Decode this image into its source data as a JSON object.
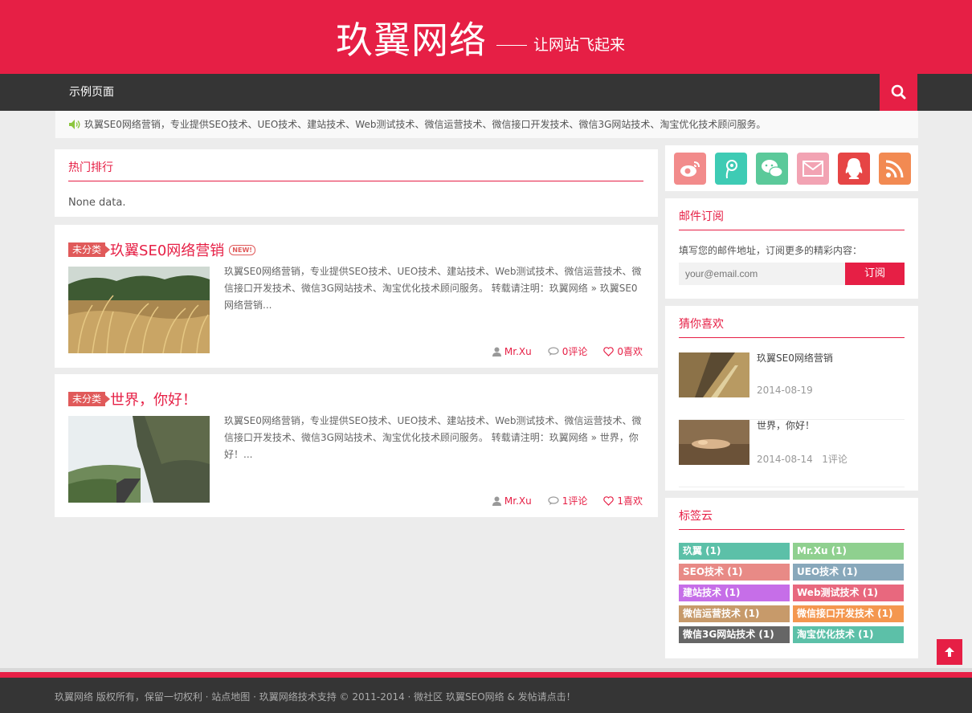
{
  "header": {
    "site_title": "玖翼网络",
    "slogan": "让网站飞起来"
  },
  "nav": {
    "items": [
      {
        "label": "示例页面"
      }
    ],
    "search_icon": "search-icon"
  },
  "notice": {
    "text": "玖翼SE0网络营销，专业提供SEO技术、UEO技术、建站技术、Web测试技术、微信运营技术、微信接口开发技术、微信3G网站技术、淘宝优化技术顾问服务。"
  },
  "hot": {
    "title": "热门排行",
    "empty_text": "None data."
  },
  "posts": [
    {
      "category": "未分类",
      "title": "玖翼SE0网络营销",
      "new_badge": "NEW!",
      "excerpt": "玖翼SE0网络营销，专业提供SEO技术、UEO技术、建站技术、Web测试技术、微信运营技术、微信接口开发技术、微信3G网站技术、淘宝优化技术顾问服务。 转载请注明：玖翼网络 » 玖翼SE0网络营销...",
      "author": "Mr.Xu",
      "comments": "0评论",
      "likes": "0喜欢"
    },
    {
      "category": "未分类",
      "title": "世界，你好！",
      "excerpt": "玖翼SE0网络营销，专业提供SEO技术、UEO技术、建站技术、Web测试技术、微信运营技术、微信接口开发技术、微信3G网站技术、淘宝优化技术顾问服务。 转载请注明：玖翼网络 » 世界，你好！...",
      "author": "Mr.Xu",
      "comments": "1评论",
      "likes": "1喜欢"
    }
  ],
  "social": [
    {
      "icon": "weibo-icon",
      "color": "#f28b8b"
    },
    {
      "icon": "tencent-weibo-icon",
      "color": "#3ecbb4"
    },
    {
      "icon": "wechat-icon",
      "color": "#5bc99a"
    },
    {
      "icon": "email-icon",
      "color": "#f2a3b3"
    },
    {
      "icon": "qq-icon",
      "color": "#e64545"
    },
    {
      "icon": "rss-icon",
      "color": "#f28a52"
    }
  ],
  "subscribe": {
    "title": "邮件订阅",
    "tip": "填写您的邮件地址，订阅更多的精彩内容：",
    "placeholder": "your@email.com",
    "button": "订阅"
  },
  "guess": {
    "title": "猜你喜欢",
    "items": [
      {
        "title": "玖翼SE0网络营销",
        "date": "2014-08-19",
        "comments": ""
      },
      {
        "title": "世界，你好！",
        "date": "2014-08-14",
        "comments": "1评论"
      }
    ]
  },
  "tags": {
    "title": "标签云",
    "items": [
      {
        "label": "玖翼 (1)",
        "color": "#5cc0a8"
      },
      {
        "label": "Mr.Xu (1)",
        "color": "#8fd08f"
      },
      {
        "label": "SEO技术 (1)",
        "color": "#e88a86"
      },
      {
        "label": "UEO技术 (1)",
        "color": "#88a8bb"
      },
      {
        "label": "建站技术 (1)",
        "color": "#c66ee8"
      },
      {
        "label": "Web测试技术 (1)",
        "color": "#e8687e"
      },
      {
        "label": "微信运营技术 (1)",
        "color": "#c79a6a"
      },
      {
        "label": "微信接口开发技术 (1)",
        "color": "#f4974f"
      },
      {
        "label": "微信3G网站技术 (1)",
        "color": "#666666"
      },
      {
        "label": "淘宝优化技术 (1)",
        "color": "#5cc0a8"
      }
    ]
  },
  "footer": {
    "text": "玖翼网络 版权所有，保留一切权利 · 站点地图 · 玖翼网络技术支持 © 2011-2014 · 微社区 玖翼SEO网络 & 发帖请点击！"
  }
}
